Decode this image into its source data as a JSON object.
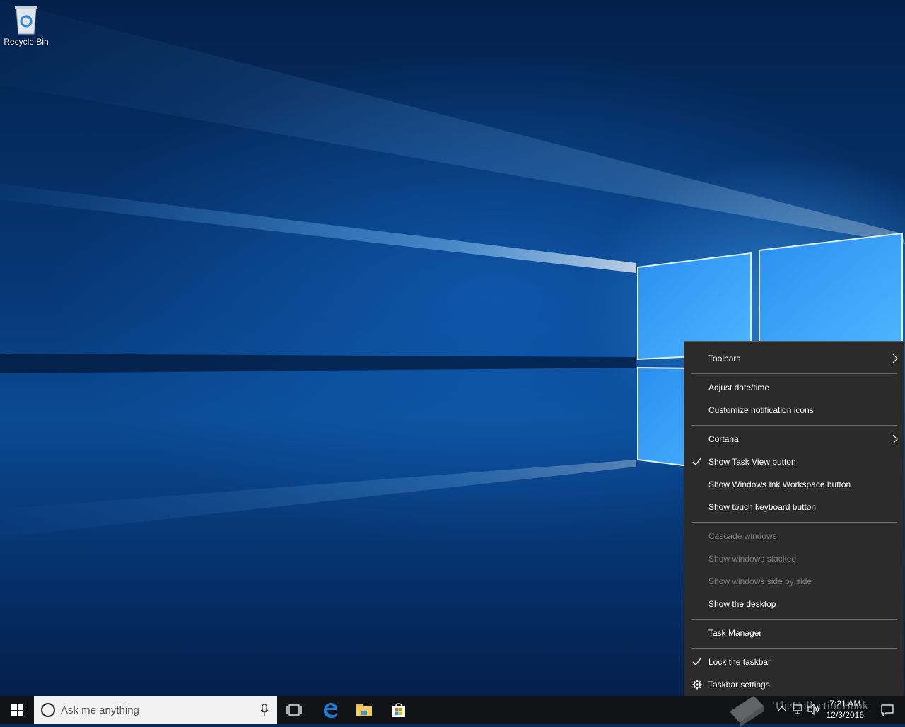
{
  "desktop": {
    "icons": [
      {
        "label": "Recycle Bin",
        "icon": "recycle-bin-icon"
      }
    ]
  },
  "taskbar": {
    "search_placeholder": "Ask me anything",
    "date": "12/3/2016",
    "time": "7:21 AM"
  },
  "watermark": {
    "text": "TheCollectionBook"
  },
  "context_menu": {
    "toolbars": "Toolbars",
    "adjust_datetime": "Adjust date/time",
    "customize_notification_icons": "Customize notification icons",
    "cortana": "Cortana",
    "show_task_view_button": "Show Task View button",
    "show_ink_workspace_button": "Show Windows Ink Workspace button",
    "show_touch_keyboard_button": "Show touch keyboard button",
    "cascade_windows": "Cascade windows",
    "show_windows_stacked": "Show windows stacked",
    "show_windows_side_by_side": "Show windows side by side",
    "show_the_desktop": "Show the desktop",
    "task_manager": "Task Manager",
    "lock_the_taskbar": "Lock the taskbar",
    "taskbar_settings": "Taskbar settings"
  },
  "colors": {
    "menu_background": "#2b2b2b",
    "disabled_text": "#7a7a7a",
    "taskbar": "#101215",
    "edge_blue": "#1e7bd6"
  }
}
